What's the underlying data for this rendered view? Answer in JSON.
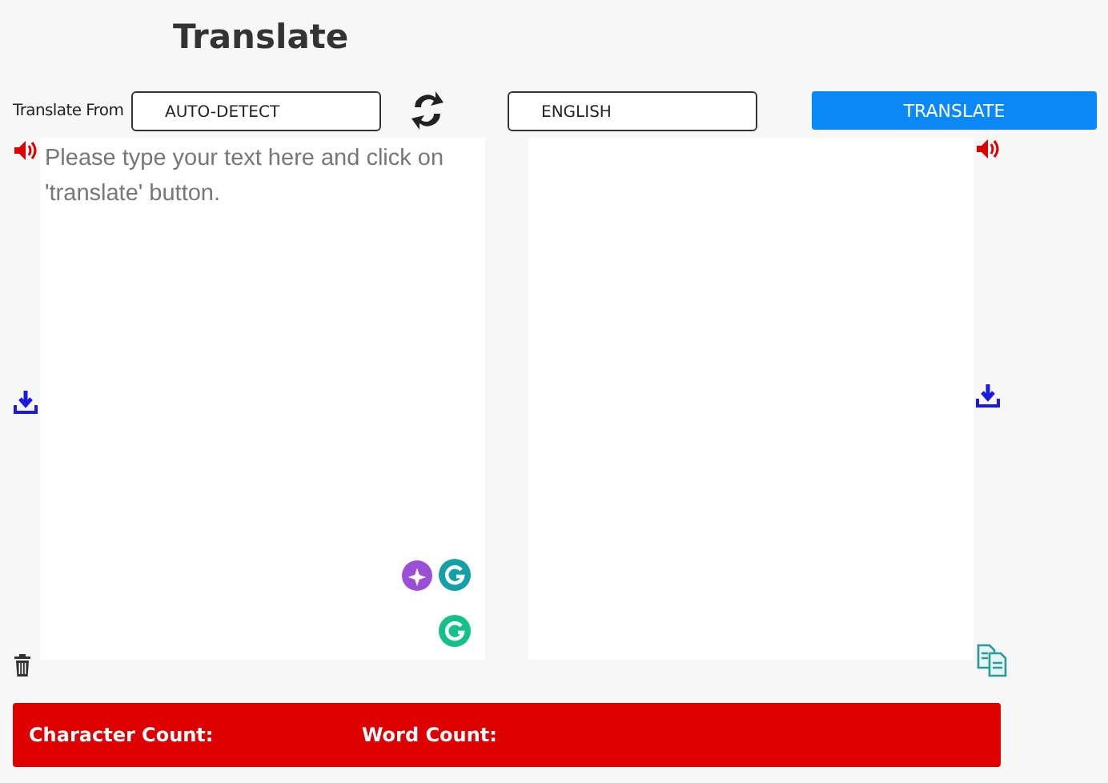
{
  "title": "Translate",
  "source": {
    "label": "Translate From",
    "language": "AUTO-DETECT",
    "placeholder": "Please type your text here and click on 'translate' button."
  },
  "target": {
    "language": "ENGLISH"
  },
  "translate_button": "TRANSLATE",
  "status_bar": {
    "character_count_label": "Character Count:",
    "word_count_label": "Word Count:"
  }
}
